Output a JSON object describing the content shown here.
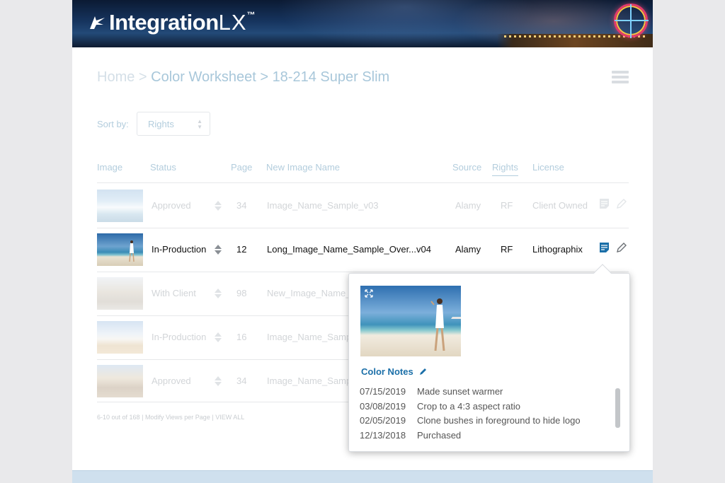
{
  "brand": {
    "name_bold": "Integration",
    "name_light": "LX",
    "trademark": "™"
  },
  "breadcrumb": {
    "home": "Home",
    "sep1": ">",
    "level1": "Color Worksheet",
    "sep2": ">",
    "level2": "18-214 Super Slim"
  },
  "sort": {
    "label": "Sort by:",
    "value": "Rights"
  },
  "table": {
    "headers": {
      "image": "Image",
      "status": "Status",
      "page": "Page",
      "name": "New Image Name",
      "source": "Source",
      "rights": "Rights",
      "license": "License"
    },
    "rows": [
      {
        "status": "Approved",
        "page": "34",
        "name": "Image_Name_Sample_v03",
        "source": "Alamy",
        "rights": "RF",
        "license": "Client Owned"
      },
      {
        "status": "In-Production",
        "page": "12",
        "name": "Long_Image_Name_Sample_Over...v04",
        "source": "Alamy",
        "rights": "RF",
        "license": "Lithographix"
      },
      {
        "status": "With Client",
        "page": "98",
        "name": "New_Image_Name_0"
      },
      {
        "status": "In-Production",
        "page": "16",
        "name": "Image_Name_Samp"
      },
      {
        "status": "Approved",
        "page": "34",
        "name": "Image_Name_Samp"
      }
    ]
  },
  "footer": {
    "range": "6-10 out of 168",
    "sep": "|",
    "modify": "Modify Views per Page",
    "sep2": "|",
    "view_all": "VIEW ALL"
  },
  "popup": {
    "title": "Color Notes",
    "notes": [
      {
        "date": "07/15/2019",
        "text": "Made sunset warmer"
      },
      {
        "date": "03/08/2019",
        "text": "Crop to a 4:3 aspect ratio"
      },
      {
        "date": "02/05/2019",
        "text": "Clone bushes in foreground to hide logo"
      },
      {
        "date": "12/13/2018",
        "text": "Purchased"
      }
    ]
  },
  "colors": {
    "accent": "#1b6fa8",
    "header_text": "#b3cddd",
    "muted": "#d2d5d8"
  }
}
